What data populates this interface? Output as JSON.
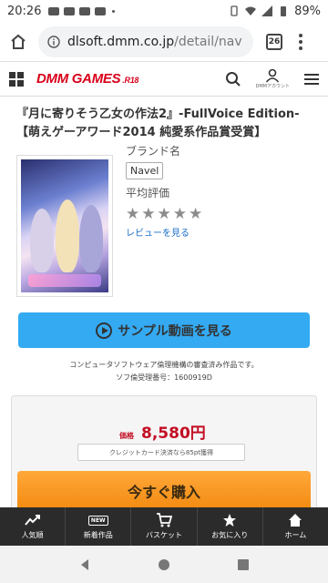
{
  "status_bar": {
    "time": "20:26",
    "battery": "89%"
  },
  "browser": {
    "url_host": "dlsoft.dmm.co.jp",
    "url_path": "/detail/nav",
    "tab_count": "26"
  },
  "site": {
    "logo": "DMM GAMES",
    "logo_suffix": ".R18",
    "account_label": "DMMアカウント"
  },
  "product": {
    "title": "『月に寄りそう乙女の作法2』-FullVoice Edition-【萌えゲーアワード2014 純愛系作品賞受賞】",
    "brand_label": "ブランド名",
    "brand": "Navel",
    "rating_label": "平均評価",
    "stars": [
      "★",
      "★",
      "★",
      "★",
      "★"
    ],
    "rating_filled": 0,
    "review_link": "レビューを見る"
  },
  "sample_button": "サンプル動画を見る",
  "notice": {
    "line1": "コンピュータソフトウェア倫理機構の審査済み作品です。",
    "line2": "ソフ倫受理番号：1600919D"
  },
  "purchase": {
    "price_label": "価格",
    "price": "8,580円",
    "points_note": "クレジットカード決済なら85pt獲得",
    "buy_button": "今すぐ購入"
  },
  "bottom_nav": [
    {
      "label": "人気順",
      "icon": "trending-icon"
    },
    {
      "label": "新着作品",
      "icon": "new-badge-icon",
      "badge": "NEW"
    },
    {
      "label": "バスケット",
      "icon": "cart-icon"
    },
    {
      "label": "お気に入り",
      "icon": "star-icon"
    },
    {
      "label": "ホーム",
      "icon": "home-icon"
    }
  ],
  "colors": {
    "brand_red": "#d8001a",
    "sample_blue": "#34aaf2",
    "buy_orange": "#f28a10",
    "price_red": "#c30d23",
    "nav_dark": "#2b2b2b"
  }
}
